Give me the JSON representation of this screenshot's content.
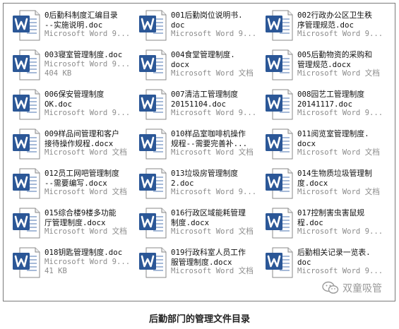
{
  "files": [
    {
      "name": "0后勤科制度汇编目录\n--实施说明.doc",
      "type": "Microsoft Word 9...",
      "size": ""
    },
    {
      "name": "001后勤岗位说明书.\ndoc",
      "type": "Microsoft Word 9...",
      "size": ""
    },
    {
      "name": "002行政办公区卫生秩\n序管理规范.doc",
      "type": "Microsoft Word 9...",
      "size": ""
    },
    {
      "name": "003寝室管理制度.doc",
      "type": "Microsoft Word 9...",
      "size": "404 KB"
    },
    {
      "name": "004食堂管理制度.\ndocx",
      "type": "Microsoft Word 文档",
      "size": ""
    },
    {
      "name": "005后勤物资的采购和\n管理规范.docx",
      "type": "Microsoft Word 文档",
      "size": ""
    },
    {
      "name": "006保安管理制度\nOK.doc",
      "type": "Microsoft Word 9...",
      "size": ""
    },
    {
      "name": "007清洁工管理制度\n20151104.doc",
      "type": "Microsoft Word 9...",
      "size": ""
    },
    {
      "name": "008园艺工管理制度\n20141117.doc",
      "type": "Microsoft Word 9...",
      "size": ""
    },
    {
      "name": "009样品间管理和客户\n接待操作规程.docx",
      "type": "Microsoft Word 文档",
      "size": ""
    },
    {
      "name": "010样品室咖啡机操作\n规程--需要完善补...",
      "type": "Microsoft Word 文档",
      "size": ""
    },
    {
      "name": "011阅览室管理制度.\ndocx",
      "type": "Microsoft Word 文档",
      "size": ""
    },
    {
      "name": "012员工网吧管理制度\n--需要编写.docx",
      "type": "Microsoft Word 文档",
      "size": ""
    },
    {
      "name": "013垃圾房管理制度\n2.doc",
      "type": "Microsoft Word 9...",
      "size": ""
    },
    {
      "name": "014生物质垃圾管理制\n度.docx",
      "type": "Microsoft Word 文档",
      "size": ""
    },
    {
      "name": "015综合楼9楼多功能\n厅管理制度.docx",
      "type": "Microsoft Word 文档",
      "size": ""
    },
    {
      "name": "016行政区域能耗管理\n制度.docx",
      "type": "Microsoft Word 文档",
      "size": ""
    },
    {
      "name": "017控制害虫害鼠规\n程.doc",
      "type": "Microsoft Word 9...",
      "size": ""
    },
    {
      "name": "018钥匙管理制度.doc",
      "type": "Microsoft Word 9...",
      "size": "41 KB"
    },
    {
      "name": "019行政科室人员工作\n服管理制度.docx",
      "type": "Microsoft Word 文档",
      "size": ""
    },
    {
      "name": "后勤相关记录一览表.\ndoc",
      "type": "Microsoft Word 9...",
      "size": ""
    }
  ],
  "watermark": {
    "text": "双童吸管",
    "icon": "wechat-icon"
  },
  "caption": "后勤部门的管理文件目录",
  "colors": {
    "word_blue": "#2b5797",
    "border": "#7a7a7a"
  }
}
